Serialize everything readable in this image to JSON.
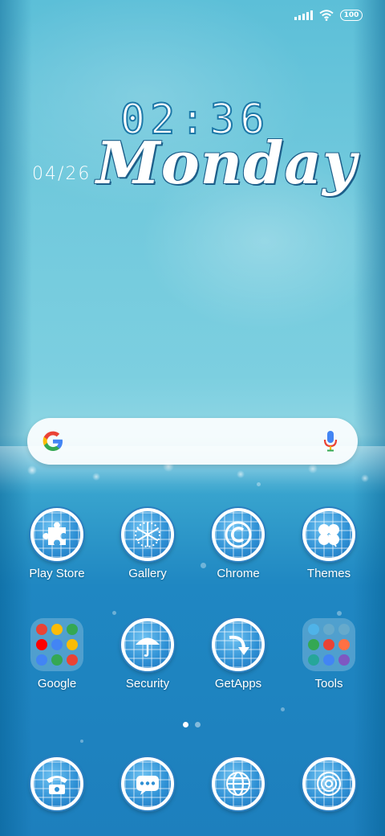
{
  "status_bar": {
    "battery": "100",
    "icons": [
      "signal-icon",
      "wifi-icon",
      "battery-icon"
    ]
  },
  "clock_widget": {
    "time": "02:36",
    "date": "04/26",
    "day": "Monday"
  },
  "search_bar": {
    "icons": [
      "google-logo-icon",
      "microphone-icon"
    ]
  },
  "home_grid": {
    "row1": [
      {
        "label": "Play Store",
        "icon": "puzzle-icon"
      },
      {
        "label": "Gallery",
        "icon": "snowflake-icon"
      },
      {
        "label": "Chrome",
        "icon": "copyright-icon"
      },
      {
        "label": "Themes",
        "icon": "clover-icon"
      }
    ],
    "row2": [
      {
        "label": "Google",
        "icon": "folder-icon"
      },
      {
        "label": "Security",
        "icon": "umbrella-icon"
      },
      {
        "label": "GetApps",
        "icon": "arrow-curve-icon"
      },
      {
        "label": "Tools",
        "icon": "folder-icon"
      }
    ]
  },
  "page_indicator": {
    "pages": 2,
    "current": 1
  },
  "dock": [
    {
      "icon": "phone-icon"
    },
    {
      "icon": "message-icon"
    },
    {
      "icon": "globe-icon"
    },
    {
      "icon": "camera-lens-icon"
    }
  ],
  "colors": {
    "accent": "#2d8fd4",
    "icon_ring": "#ffffff",
    "google_blue": "#4285F4",
    "google_red": "#EA4335",
    "google_yellow": "#FBBC05",
    "google_green": "#34A853"
  }
}
